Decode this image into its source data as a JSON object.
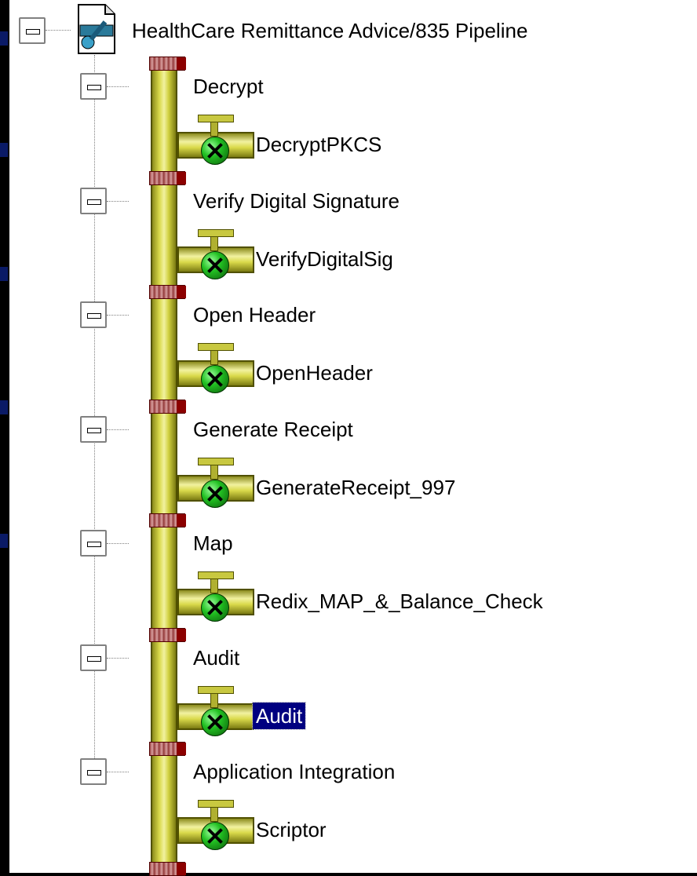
{
  "tree": {
    "root_label": "HealthCare Remittance Advice/835 Pipeline",
    "stages": [
      {
        "label": "Decrypt",
        "component": "DecryptPKCS"
      },
      {
        "label": "Verify Digital Signature",
        "component": "VerifyDigitalSig"
      },
      {
        "label": "Open Header",
        "component": "OpenHeader"
      },
      {
        "label": "Generate Receipt",
        "component": "GenerateReceipt_997"
      },
      {
        "label": "Map",
        "component": "Redix_MAP_&_Balance_Check"
      },
      {
        "label": "Audit",
        "component": "Audit"
      },
      {
        "label": "Application Integration",
        "component": "Scriptor"
      }
    ],
    "selected_component": "Audit"
  },
  "icons": {
    "root": "pipeline-document-icon",
    "stage": "collapse-icon",
    "component": "valve-component-icon"
  },
  "colors": {
    "selection_background": "#000080",
    "selection_text": "#ffffff",
    "pipe": "#d9d94a",
    "valve_ball": "#22c022"
  }
}
